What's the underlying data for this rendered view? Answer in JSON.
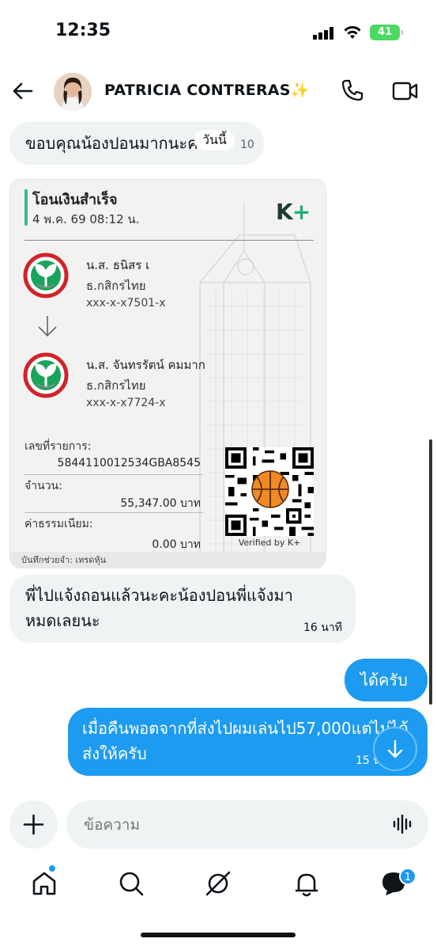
{
  "status_bar": {
    "time": "12:35",
    "battery": "41"
  },
  "header": {
    "contact_name": "PATRICIA CONTRERAS✨"
  },
  "messages": {
    "incoming_1": "ขอบคุณน้องปอนมากนะคะ",
    "incoming_1_time": "10",
    "today_label": "วันนี้",
    "incoming_2": "พี่ไปแจ้งถอนแล้วนะคะน้องปอนพี่แจ้งมาหมดเลยนะ",
    "incoming_2_time": "16 นาที",
    "outgoing_1": "ได้ครับ",
    "outgoing_2": "เมื่อคืนพอตจากที่ส่งไปผมเล่นไป57,000แต่ไม่ได้ส่งให้ครับ",
    "outgoing_2_time": "15 นาที"
  },
  "slip": {
    "title": "โอนเงินสำเร็จ",
    "datetime": "4 พ.ค. 69 08:12 น.",
    "brand": "K",
    "brand_plus": "+",
    "sender": {
      "name": "น.ส. ธนิสร เ",
      "bank": "ธ.กสิกรไทย",
      "account": "xxx-x-x7501-x"
    },
    "receiver": {
      "name": "น.ส. จันทรรัตน์ คมมาก",
      "bank": "ธ.กสิกรไทย",
      "account": "xxx-x-x7724-x"
    },
    "ref_label": "เลขที่รายการ:",
    "ref_value": "5844110012534GBA8545",
    "amount_label": "จำนวน:",
    "amount_value": "55,347.00 บาท",
    "fee_label": "ค่าธรรมเนียม:",
    "fee_value": "0.00 บาท",
    "verified": "Verified by K+",
    "memo": "บันทึกช่วยจำ: เทรดหุ้น"
  },
  "composer": {
    "placeholder": "ข้อความ"
  },
  "tabbar": {
    "messages_badge": "1"
  },
  "colors": {
    "accent": "#1d9bf0",
    "bubble_in": "#eff3f4",
    "kbank_green": "#1fae75"
  },
  "icons": [
    "back-arrow-icon",
    "phone-icon",
    "video-icon",
    "plus-icon",
    "voice-icon",
    "home-icon",
    "search-icon",
    "grok-icon",
    "bell-icon",
    "messages-icon",
    "arrow-down-icon"
  ]
}
